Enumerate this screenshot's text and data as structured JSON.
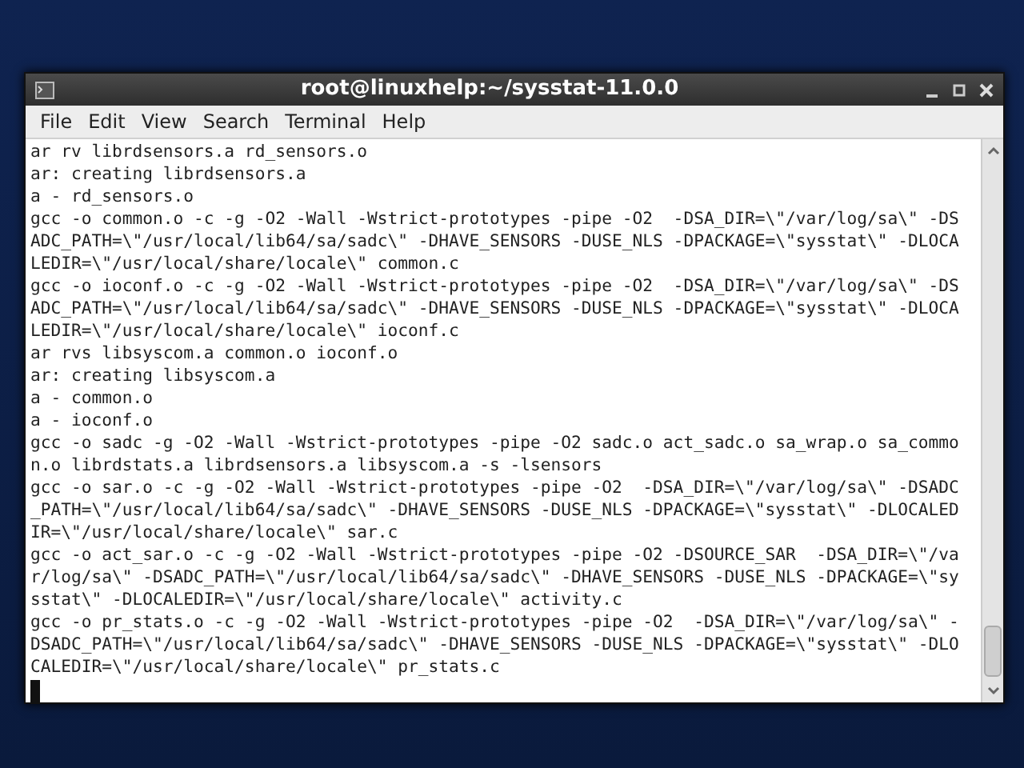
{
  "window": {
    "title": "root@linuxhelp:~/sysstat-11.0.0"
  },
  "menu": [
    "File",
    "Edit",
    "View",
    "Search",
    "Terminal",
    "Help"
  ],
  "terminal": {
    "lines": [
      "ar rv librdsensors.a rd_sensors.o",
      "ar: creating librdsensors.a",
      "a - rd_sensors.o",
      "gcc -o common.o -c -g -O2 -Wall -Wstrict-prototypes -pipe -O2  -DSA_DIR=\\\"/var/log/sa\\\" -DS",
      "ADC_PATH=\\\"/usr/local/lib64/sa/sadc\\\" -DHAVE_SENSORS -DUSE_NLS -DPACKAGE=\\\"sysstat\\\" -DLOCA",
      "LEDIR=\\\"/usr/local/share/locale\\\" common.c",
      "gcc -o ioconf.o -c -g -O2 -Wall -Wstrict-prototypes -pipe -O2  -DSA_DIR=\\\"/var/log/sa\\\" -DS",
      "ADC_PATH=\\\"/usr/local/lib64/sa/sadc\\\" -DHAVE_SENSORS -DUSE_NLS -DPACKAGE=\\\"sysstat\\\" -DLOCA",
      "LEDIR=\\\"/usr/local/share/locale\\\" ioconf.c",
      "ar rvs libsyscom.a common.o ioconf.o",
      "ar: creating libsyscom.a",
      "a - common.o",
      "a - ioconf.o",
      "gcc -o sadc -g -O2 -Wall -Wstrict-prototypes -pipe -O2 sadc.o act_sadc.o sa_wrap.o sa_commo",
      "n.o librdstats.a librdsensors.a libsyscom.a -s -lsensors",
      "gcc -o sar.o -c -g -O2 -Wall -Wstrict-prototypes -pipe -O2  -DSA_DIR=\\\"/var/log/sa\\\" -DSADC",
      "_PATH=\\\"/usr/local/lib64/sa/sadc\\\" -DHAVE_SENSORS -DUSE_NLS -DPACKAGE=\\\"sysstat\\\" -DLOCALED",
      "IR=\\\"/usr/local/share/locale\\\" sar.c",
      "gcc -o act_sar.o -c -g -O2 -Wall -Wstrict-prototypes -pipe -O2 -DSOURCE_SAR  -DSA_DIR=\\\"/va",
      "r/log/sa\\\" -DSADC_PATH=\\\"/usr/local/lib64/sa/sadc\\\" -DHAVE_SENSORS -DUSE_NLS -DPACKAGE=\\\"sy",
      "sstat\\\" -DLOCALEDIR=\\\"/usr/local/share/locale\\\" activity.c",
      "gcc -o pr_stats.o -c -g -O2 -Wall -Wstrict-prototypes -pipe -O2  -DSA_DIR=\\\"/var/log/sa\\\" -",
      "DSADC_PATH=\\\"/usr/local/lib64/sa/sadc\\\" -DHAVE_SENSORS -DUSE_NLS -DPACKAGE=\\\"sysstat\\\" -DLO",
      "CALEDIR=\\\"/usr/local/share/locale\\\" pr_stats.c"
    ],
    "cursor": true
  }
}
